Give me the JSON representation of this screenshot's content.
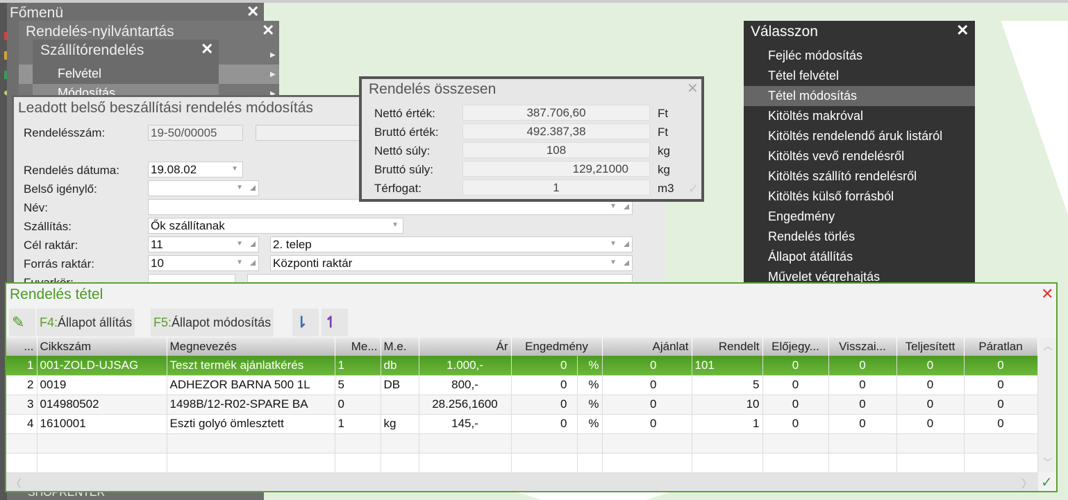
{
  "main_menu": {
    "title": "Főmenü",
    "footer": "SHOPRENTER"
  },
  "orders_menu": {
    "title": "Rendelés-nyilvántartás"
  },
  "supplier_menu": {
    "title": "Szállítórendelés",
    "items": [
      "Felvétel",
      "Módosítás"
    ]
  },
  "form": {
    "title": "Leadott belső beszállítási rendelés módosítás",
    "fields": {
      "order_no_label": "Rendelésszám:",
      "order_no": "19-50/00005",
      "date_label": "Rendelés dátuma:",
      "date": "19.08.02",
      "requester_label": "Belső igénylő:",
      "requester": "",
      "name_label": "Név:",
      "name": "",
      "shipping_label": "Szállítás:",
      "shipping": "Ők szállítanak",
      "target_label": "Cél raktár:",
      "target_code": "11",
      "target_name": "2. telep",
      "source_label": "Forrás raktár:",
      "source_code": "10",
      "source_name": "Központi raktár",
      "route_label": "Fuvarkör:"
    }
  },
  "summary": {
    "title": "Rendelés összesen",
    "rows": [
      {
        "label": "Nettó érték:",
        "value": "387.706,60",
        "unit": "Ft"
      },
      {
        "label": "Bruttó érték:",
        "value": "492.387,38",
        "unit": "Ft"
      },
      {
        "label": "Nettó súly:",
        "value": "108",
        "unit": "kg"
      },
      {
        "label": "Bruttó súly:",
        "value": "129,21000",
        "unit": "kg"
      },
      {
        "label": "Térfogat:",
        "value": "1",
        "unit": "m3"
      }
    ]
  },
  "choose_menu": {
    "title": "Válasszon",
    "selected": 2,
    "items": [
      "Fejléc módosítás",
      "Tétel felvétel",
      "Tétel módosítás",
      "Kitöltés makróval",
      "Kitöltés rendelendő áruk listáról",
      "Kitöltés vevő rendelésről",
      "Kitöltés szállító rendelésről",
      "Kitöltés külső forrásból",
      "Engedmény",
      "Rendelés törlés",
      "Állapot átállítás",
      "Művelet végrehajtás"
    ]
  },
  "items": {
    "title": "Rendelés tétel",
    "toolbar": {
      "f4_key": "F4:",
      "f4_label": "Állapot állítás",
      "f5_key": "F5:",
      "f5_label": "Állapot módosítás"
    },
    "columns": [
      "...",
      "Cikkszám",
      "Megnevezés",
      "Me...",
      "M.e.",
      "Ár",
      "Engedmény",
      "Ajánlat",
      "Rendelt",
      "Előjegy...",
      "Visszai...",
      "Teljesített",
      "Páratlan"
    ],
    "rows": [
      [
        "1",
        "001-ZOLD-UJSAG",
        "Teszt termék ajánlatkérés",
        "1",
        "db",
        "1.000,-",
        "0",
        "%",
        "0",
        "101",
        "0",
        "0",
        "0",
        "0"
      ],
      [
        "2",
        "0019",
        "ADHEZOR BARNA 500 1L",
        "5",
        "DB",
        "800,-",
        "0",
        "%",
        "0",
        "5",
        "0",
        "0",
        "0",
        "0"
      ],
      [
        "3",
        "014980502",
        "1498B/12-R02-SPARE BA",
        "0",
        "",
        "28.256,1600",
        "0",
        "%",
        "0",
        "10",
        "0",
        "0",
        "0",
        "0"
      ],
      [
        "4",
        "1610001",
        "Eszti golyó ömlesztett",
        "1",
        "kg",
        "145,-",
        "0",
        "%",
        "0",
        "1",
        "0",
        "0",
        "0",
        "0"
      ]
    ],
    "selected_row": 0
  },
  "colors": {
    "accent": "#5ba22e",
    "menu_bg": "#333333",
    "window_gray": "#707070"
  }
}
